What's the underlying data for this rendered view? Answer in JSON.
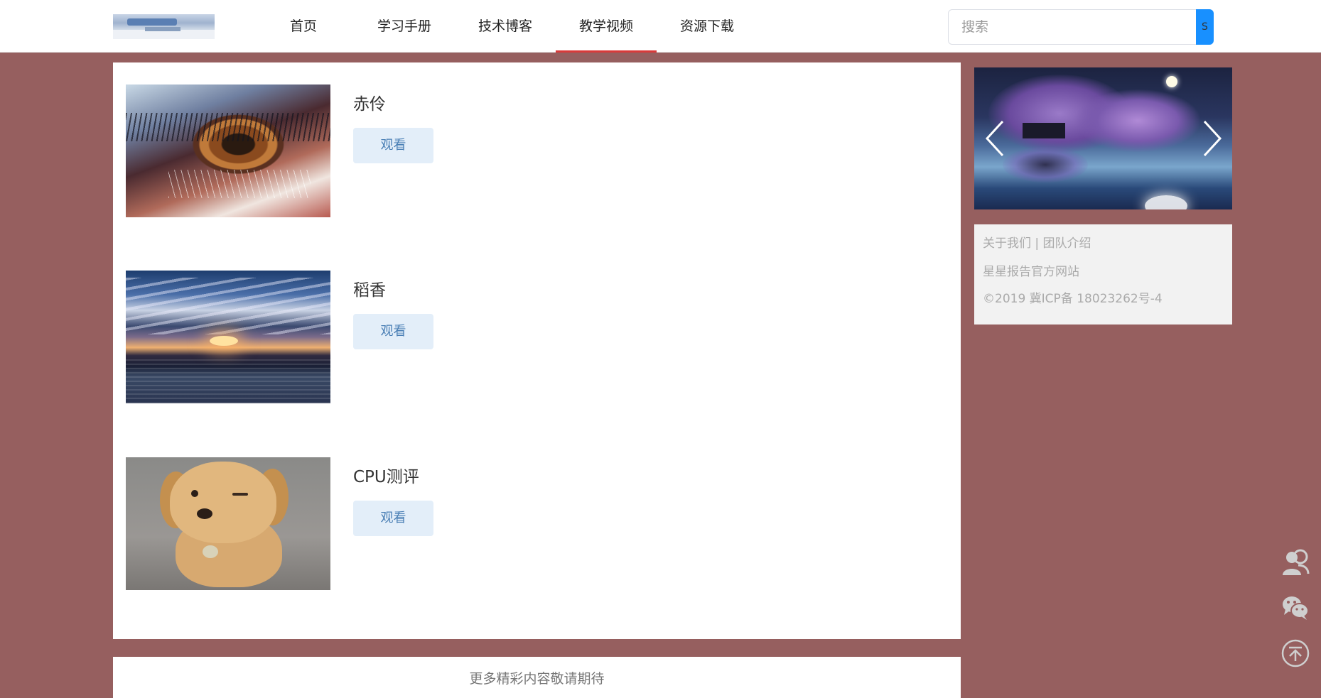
{
  "nav": {
    "items": [
      {
        "label": "首页",
        "active": false
      },
      {
        "label": "学习手册",
        "active": false
      },
      {
        "label": "技术博客",
        "active": false
      },
      {
        "label": "教学视频",
        "active": true
      },
      {
        "label": "资源下载",
        "active": false
      }
    ]
  },
  "search": {
    "placeholder": "搜索",
    "button_label": "S"
  },
  "videos": [
    {
      "title": "赤伶",
      "button_label": "观看",
      "thumbnail": "eye-closeup"
    },
    {
      "title": "稻香",
      "button_label": "观看",
      "thumbnail": "sunset-over-water"
    },
    {
      "title": "CPU测评",
      "button_label": "观看",
      "thumbnail": "winking-puppy"
    }
  ],
  "more_text": "更多精彩内容敬请期待",
  "sidebar": {
    "footer": {
      "about": "关于我们",
      "separator": " | ",
      "team": "团队介绍",
      "site": "星星报告官方网站",
      "copyright": "©2019 冀ICP备 18023262号-4"
    }
  },
  "float_tools": [
    "customer-service-icon",
    "wechat-icon",
    "back-to-top-icon"
  ],
  "colors": {
    "background": "#965f5f",
    "nav_active_underline": "#d93a3a",
    "search_button": "#1890ff",
    "watch_button_bg": "#e3eef9",
    "watch_button_text": "#4a7fb5"
  }
}
